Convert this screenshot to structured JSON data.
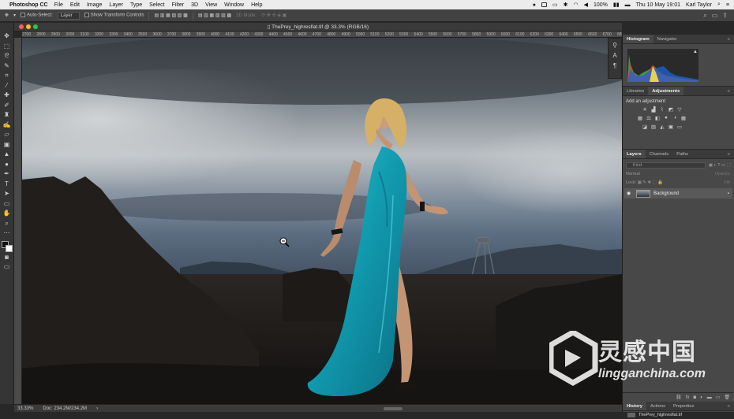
{
  "mac_menubar": {
    "apple_glyph": "",
    "app_name": "Photoshop CC",
    "menus": [
      "File",
      "Edit",
      "Image",
      "Layer",
      "Type",
      "Select",
      "Filter",
      "3D",
      "View",
      "Window",
      "Help"
    ],
    "battery": "100%",
    "datetime": "Thu 10 May  19:01",
    "user": "Karl Taylor"
  },
  "options_bar": {
    "auto_select_label": "Auto-Select:",
    "auto_select_value": "Layer",
    "transform_label": "Show Transform Controls",
    "mode_3d_label": "3D Mode:"
  },
  "tools": [
    "move",
    "marquee",
    "lasso",
    "quick-select",
    "crop",
    "eyedropper",
    "healing",
    "brush",
    "stamp",
    "history-brush",
    "eraser",
    "gradient",
    "blur",
    "dodge",
    "pen",
    "type",
    "path-select",
    "shape",
    "hand",
    "zoom",
    "more"
  ],
  "document": {
    "title": "ThePrey_highresflat.tif @ 33.3% (RGB/16)",
    "zoom": "33.33%",
    "doc_size": "Doc: 234.2M/234.2M"
  },
  "ruler_ticks": [
    "2700",
    "2800",
    "2900",
    "3000",
    "3100",
    "3200",
    "3300",
    "3400",
    "3500",
    "3600",
    "3700",
    "3800",
    "3900",
    "4000",
    "4100",
    "4200",
    "4300",
    "4400",
    "4500",
    "4600",
    "4700",
    "4800",
    "4900",
    "5000",
    "5100",
    "5200",
    "5300",
    "5400",
    "5500",
    "5600",
    "5700",
    "5800",
    "5900",
    "6000",
    "6100",
    "6200",
    "6300",
    "6400",
    "6500",
    "6600",
    "6700",
    "6800",
    "6900",
    "7000",
    "7100"
  ],
  "panels": {
    "histogram_tabs": [
      "Histogram",
      "Navigator"
    ],
    "adjust_tabs": [
      "Libraries",
      "Adjustments"
    ],
    "add_adjustment": "Add an adjustment",
    "layers_tabs": [
      "Layers",
      "Channels",
      "Paths"
    ],
    "kind_placeholder": "Kind",
    "blend_mode": "Normal",
    "opacity_label": "Opacity:",
    "lock_label": "Lock:",
    "fill_label": "Fill:",
    "layer_name": "Background",
    "history_tabs": [
      "History",
      "Actions",
      "Properties"
    ],
    "history_item": "ThePrey_highresflat.tif"
  },
  "watermark": {
    "cn": "灵感中国",
    "en": "lingganchina.com"
  },
  "colors": {
    "dress": "#1aa7b8",
    "sky": "#8f9aa5",
    "ground": "#1a1816"
  }
}
